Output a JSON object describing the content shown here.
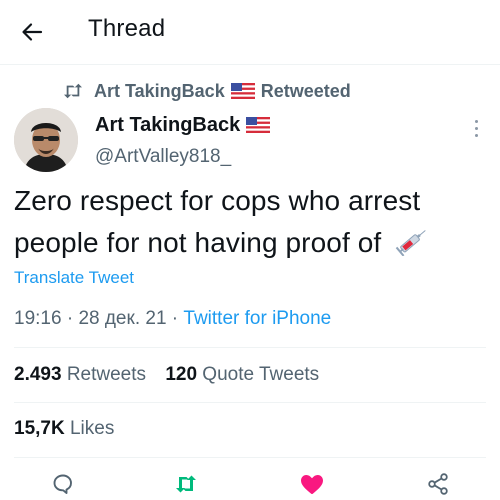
{
  "header": {
    "title": "Thread",
    "back_icon": "arrow-left-icon"
  },
  "retweet_context": {
    "icon": "retweet-icon",
    "user": "Art TakingBack",
    "flag": "us-flag-emoji",
    "label": "Retweeted"
  },
  "author": {
    "name": "Art TakingBack",
    "flag": "us-flag-emoji",
    "handle": "@ArtValley818_"
  },
  "tweet": {
    "text": "Zero respect for cops who arrest people for not having proof of",
    "emoji": "syringe-emoji",
    "translate_label": "Translate Tweet",
    "time": "19:16",
    "separator": "·",
    "date": "28 дек. 21",
    "source": "Twitter for iPhone"
  },
  "stats": {
    "retweets_count": "2.493",
    "retweets_label": "Retweets",
    "quotes_count": "120",
    "quotes_label": "Quote Tweets",
    "likes_count": "15,7K",
    "likes_label": "Likes"
  },
  "actions": [
    {
      "name": "reply",
      "icon": "reply-icon",
      "color": "#536471"
    },
    {
      "name": "retweet",
      "icon": "retweet-icon",
      "color": "#00ba7c",
      "active": true
    },
    {
      "name": "like",
      "icon": "heart-icon",
      "color": "#f91880",
      "active": true
    },
    {
      "name": "share",
      "icon": "share-icon",
      "color": "#536471"
    }
  ],
  "colors": {
    "accent": "#1d9bf0",
    "secondary_text": "#536471",
    "retweet_green": "#00ba7c",
    "like_pink": "#f91880"
  }
}
